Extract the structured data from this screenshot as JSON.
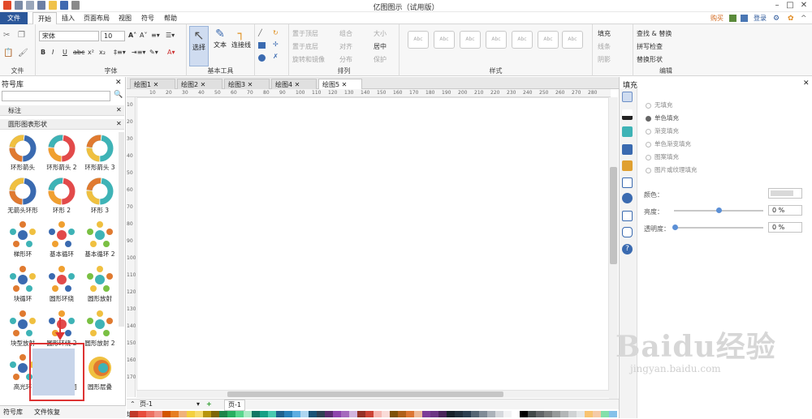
{
  "window": {
    "title": "亿图图示（试用版）"
  },
  "menubar": {
    "file": "文件",
    "tabs": [
      "开始",
      "插入",
      "页面布局",
      "视图",
      "符号",
      "帮助"
    ],
    "active": "开始",
    "right": {
      "buy": "购买",
      "login": "登录"
    }
  },
  "ribbon": {
    "font": {
      "family": "宋体",
      "size": "10",
      "group": "文件",
      "group2": "字体"
    },
    "tools": {
      "select": "选择",
      "text": "文本",
      "connector": "连接线",
      "group": "基本工具"
    },
    "arrange": {
      "items": [
        "置于顶层",
        "组合",
        "大小",
        "置于底层",
        "对齐",
        "居中",
        "旋转和镜像",
        "分布",
        "保护"
      ],
      "group": "排列"
    },
    "styles": {
      "sample": "Abc",
      "group": "样式"
    },
    "format": {
      "fill": "填充",
      "line": "线条",
      "shadow": "阴影"
    },
    "edit": {
      "find": "查找 & 替换",
      "spell": "拼写检查",
      "replace": "替换形状",
      "group": "编辑"
    }
  },
  "library": {
    "title": "符号库",
    "section1": "标注",
    "section2": "圆形图表形状",
    "shapes": [
      "环形箭头",
      "环形箭头 2",
      "环形箭头 3",
      "无箭头环形",
      "环形 2",
      "环形 3",
      "梯形环",
      "基本循环",
      "基本循环 2",
      "块循环",
      "圆形环绕",
      "圆形放射",
      "块型放射",
      "圆形环绕 2",
      "圆形放射 2",
      "高光环",
      "多圆维恩图",
      "圆形层叠"
    ]
  },
  "tabs": {
    "docs": [
      "绘图1",
      "绘图2",
      "绘图3",
      "绘图4",
      "绘图5"
    ],
    "active": "绘图5"
  },
  "ruler": {
    "marks": [
      "10",
      "20",
      "30",
      "40",
      "50",
      "60",
      "70",
      "80",
      "90",
      "100",
      "110",
      "120",
      "130",
      "140",
      "150",
      "160",
      "170",
      "180",
      "190",
      "200",
      "210",
      "220",
      "230",
      "240",
      "250",
      "260",
      "270",
      "280"
    ],
    "vmarks": [
      "10",
      "20",
      "30",
      "40",
      "50",
      "60",
      "70",
      "80",
      "90",
      "100",
      "110",
      "120",
      "130",
      "140",
      "150",
      "160",
      "170"
    ]
  },
  "pages": {
    "page": "页-1",
    "page2": "页-1"
  },
  "bottom": {
    "lib": "符号库",
    "recovery": "文件恢复",
    "fill": "填充"
  },
  "rightpanel": {
    "title": "填充",
    "options": [
      "无填充",
      "单色填充",
      "渐变填充",
      "单色渐变填充",
      "图案填充",
      "图片或纹理填充"
    ],
    "selected": "单色填充",
    "color_label": "颜色：",
    "brightness_label": "亮度：",
    "brightness_value": "0 %",
    "transparency_label": "透明度：",
    "transparency_value": "0 %"
  },
  "watermark": {
    "text": "Baidu经验",
    "url": "jingyan.baidu.com"
  },
  "colors": {
    "accent": "#2b579a",
    "highlight": "#d33333"
  }
}
